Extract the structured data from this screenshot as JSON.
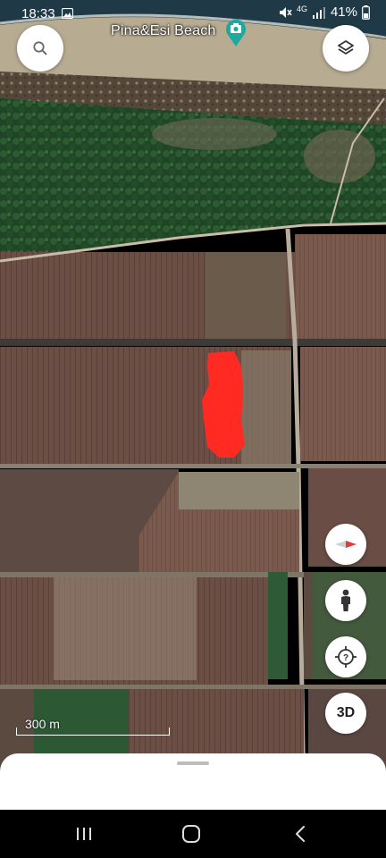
{
  "status_bar": {
    "time": "18:33",
    "network": "4G",
    "battery": "41%",
    "icons": [
      "gallery-icon",
      "mute-icon",
      "signal-icon",
      "battery-icon"
    ]
  },
  "map": {
    "place_label": "Pina&Esi Beach",
    "place_pin_icon": "camera-pin-icon",
    "highlight_color": "#ff2a22",
    "scale_label": "300 m"
  },
  "controls": {
    "search_icon": "search-icon",
    "layers_icon": "layers-icon",
    "compass_icon": "compass-icon",
    "street_view_icon": "pegman-icon",
    "voyager_icon": "help-icon",
    "toggle_3d_label": "3D"
  },
  "nav_bar": {
    "recent_icon": "recent-apps-icon",
    "home_icon": "home-icon",
    "back_icon": "back-icon"
  },
  "colors": {
    "accent_pin": "#1fa8a0",
    "compass_red": "#e53935"
  }
}
